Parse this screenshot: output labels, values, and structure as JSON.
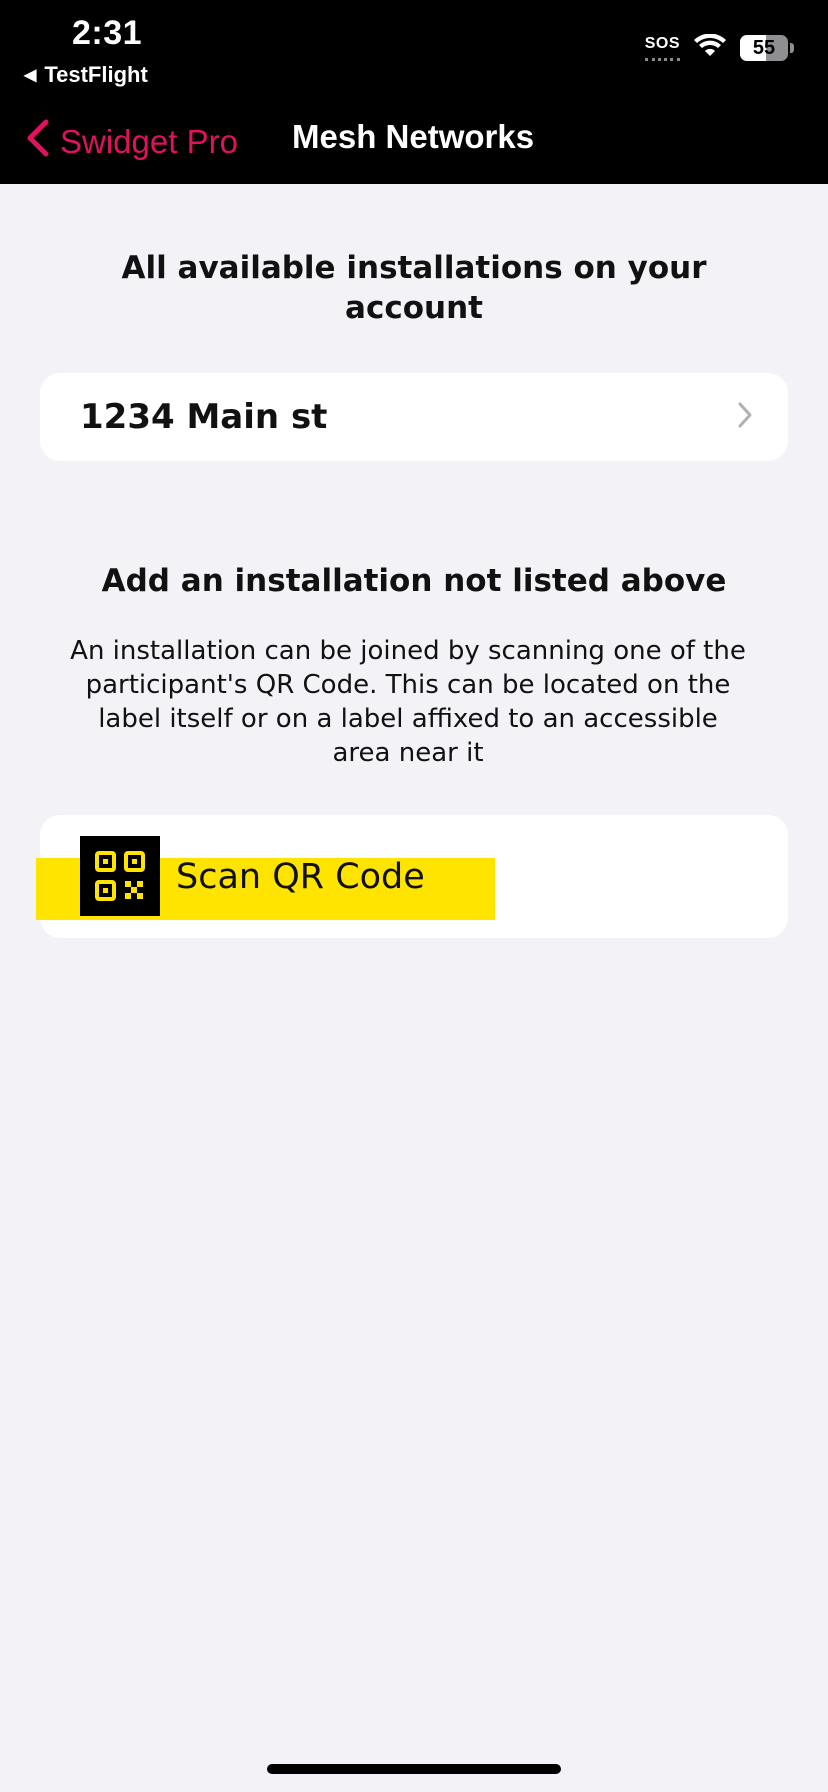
{
  "status_bar": {
    "time": "2:31",
    "back_app": "TestFlight",
    "sos": "SOS",
    "battery_percent": "55",
    "battery_level": 0.55
  },
  "nav": {
    "back_label": "Swidget Pro",
    "title": "Mesh Networks",
    "accent_color": "#e0115f"
  },
  "installations": {
    "heading": "All available installations on your account",
    "items": [
      {
        "label": "1234 Main st"
      }
    ]
  },
  "add_section": {
    "heading": "Add an installation not listed above",
    "description": "An installation can be joined by scanning one of the participant's QR Code. This can be located on the label itself or on a label affixed to an accessible area near it",
    "scan_button_label": "Scan QR Code",
    "highlight_color": "#ffe400"
  }
}
